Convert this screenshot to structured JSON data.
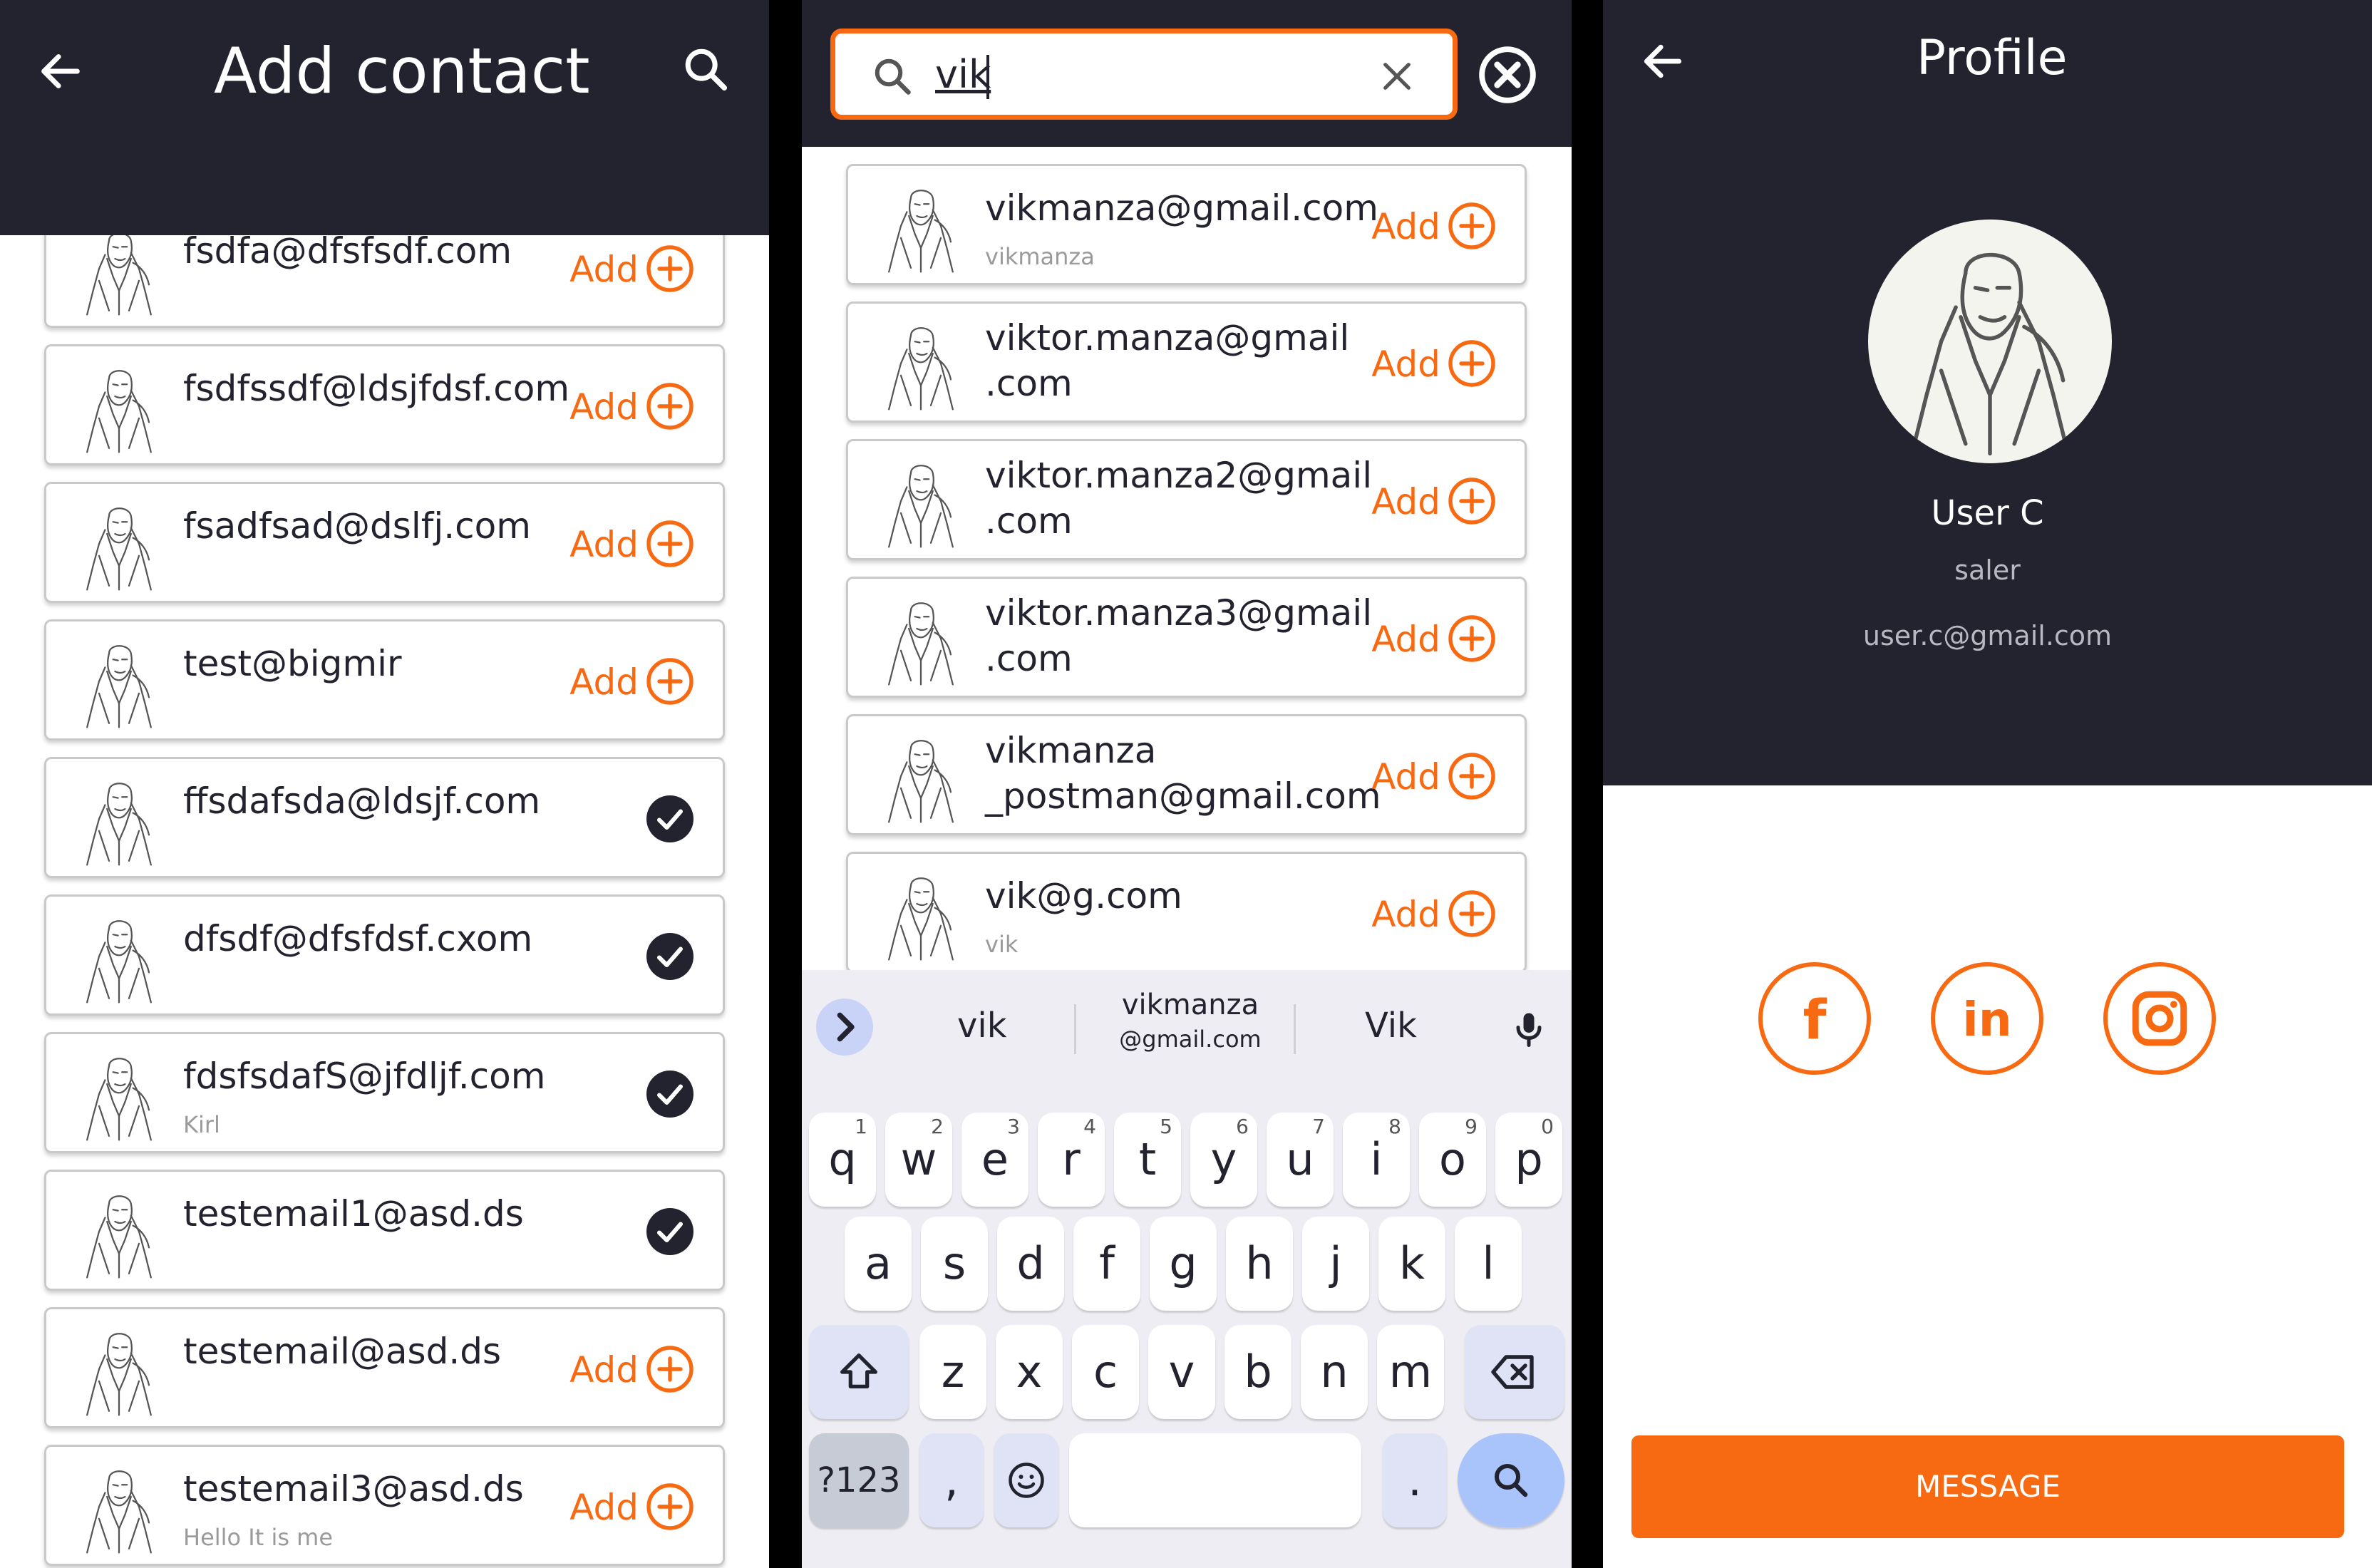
{
  "colors": {
    "accent": "#f86a12",
    "header": "#23232f",
    "check": "#23232f"
  },
  "panel1": {
    "title": "Add contact",
    "contacts": [
      {
        "email": "fsdfa@dfsfsdf.com",
        "sub": "",
        "status": "add"
      },
      {
        "email": "fsdfssdf@ldsjfdsf.com",
        "sub": "",
        "status": "add"
      },
      {
        "email": "fsadfsad@dslfj.com",
        "sub": "",
        "status": "add"
      },
      {
        "email": "test@bigmir",
        "sub": "",
        "status": "add"
      },
      {
        "email": "ffsdafsda@ldsjf.com",
        "sub": "",
        "status": "added"
      },
      {
        "email": "dfsdf@dfsfdsf.cxom",
        "sub": "",
        "status": "added"
      },
      {
        "email": "fdsfsdafS@jfdljf.com",
        "sub": "Kirl",
        "status": "added"
      },
      {
        "email": "testemail1@asd.ds",
        "sub": "",
        "status": "added"
      },
      {
        "email": "testemail@asd.ds",
        "sub": "",
        "status": "add"
      },
      {
        "email": "testemail3@asd.ds",
        "sub": "Hello It is me",
        "status": "add"
      }
    ],
    "add_label": "Add"
  },
  "panel2": {
    "query": "vik",
    "results": [
      {
        "email": "vikmanza@gmail.com",
        "sub": "vikmanza",
        "status": "add"
      },
      {
        "email": "viktor.manza@gmail .com",
        "sub": "",
        "status": "add"
      },
      {
        "email": "viktor.manza2@gmail .com",
        "sub": "",
        "status": "add"
      },
      {
        "email": "viktor.manza3@gmail .com",
        "sub": "",
        "status": "add"
      },
      {
        "email": "vikmanza _postman@gmail.com",
        "sub": "",
        "status": "add"
      },
      {
        "email": "vik@g.com",
        "sub": "vik",
        "status": "add"
      }
    ],
    "add_label": "Add",
    "keyboard": {
      "suggestions": [
        "vik",
        "vikmanza",
        "@gmail.com",
        "Vik"
      ],
      "row1": [
        "q",
        "w",
        "e",
        "r",
        "t",
        "y",
        "u",
        "i",
        "o",
        "p"
      ],
      "row1_hints": [
        "1",
        "2",
        "3",
        "4",
        "5",
        "6",
        "7",
        "8",
        "9",
        "0"
      ],
      "row2": [
        "a",
        "s",
        "d",
        "f",
        "g",
        "h",
        "j",
        "k",
        "l"
      ],
      "row3": [
        "z",
        "x",
        "c",
        "v",
        "b",
        "n",
        "m"
      ],
      "symbols_label": "?123",
      "comma": ",",
      "period": "."
    }
  },
  "panel3": {
    "title": "Profile",
    "name": "User C",
    "role": "saler",
    "email": "user.c@gmail.com",
    "social": [
      "facebook-icon",
      "linkedin-icon",
      "instagram-icon"
    ],
    "social_labels": [
      "f",
      "in"
    ],
    "message_label": "MESSAGE"
  }
}
